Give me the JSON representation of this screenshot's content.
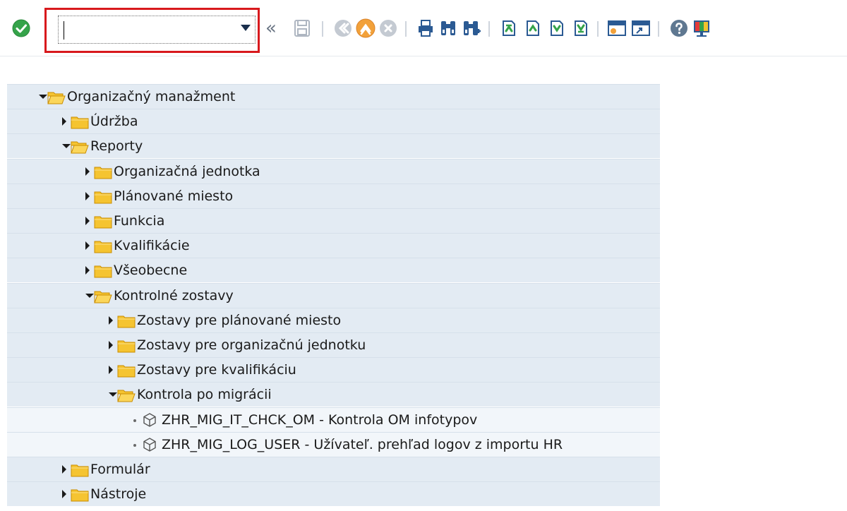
{
  "toolbar": {
    "command_field": {
      "value": "",
      "placeholder": ""
    },
    "back_glyph": "«",
    "icons": [
      "enter-icon",
      "command-dropdown-icon",
      "back-icon",
      "save-icon",
      "back-green-icon",
      "exit-icon",
      "cancel-icon",
      "print-icon",
      "find-icon",
      "find-next-icon",
      "first-page-icon",
      "previous-page-icon",
      "next-page-icon",
      "last-page-icon",
      "create-session-icon",
      "generate-shortcut-icon",
      "help-icon",
      "customize-layout-icon"
    ]
  },
  "tree": {
    "nodes": [
      {
        "label": "Organizačný manažment",
        "state": "expanded",
        "level": 0
      },
      {
        "label": "Údržba",
        "state": "collapsed",
        "level": 1
      },
      {
        "label": "Reporty",
        "state": "expanded",
        "level": 1
      },
      {
        "label": "Organizačná jednotka",
        "state": "collapsed",
        "level": 2
      },
      {
        "label": "Plánované miesto",
        "state": "collapsed",
        "level": 2
      },
      {
        "label": "Funkcia",
        "state": "collapsed",
        "level": 2
      },
      {
        "label": "Kvalifikácie",
        "state": "collapsed",
        "level": 2
      },
      {
        "label": "Všeobecne",
        "state": "collapsed",
        "level": 2
      },
      {
        "label": "Kontrolné zostavy",
        "state": "expanded",
        "level": 2
      },
      {
        "label": "Zostavy pre plánované miesto",
        "state": "collapsed",
        "level": 3
      },
      {
        "label": "Zostavy pre organizačnú jednotku",
        "state": "collapsed",
        "level": 3
      },
      {
        "label": "Zostavy pre kvalifikáciu",
        "state": "collapsed",
        "level": 3
      },
      {
        "label": "Kontrola po migrácii",
        "state": "expanded",
        "level": 3
      },
      {
        "label": "ZHR_MIG_IT_CHCK_OM - Kontrola OM infotypov",
        "state": "leaf",
        "level": 4
      },
      {
        "label": "ZHR_MIG_LOG_USER - Užívateľ. prehľad logov z importu HR",
        "state": "leaf",
        "level": 4
      },
      {
        "label": "Formulár",
        "state": "collapsed",
        "level": 1
      },
      {
        "label": "Nástroje",
        "state": "collapsed",
        "level": 1
      }
    ]
  },
  "colors": {
    "row_band": "#e3ebf3",
    "folder_fill": "#f5c431",
    "folder_stroke": "#c98c00",
    "highlight_box": "#d8191d",
    "enter_green": "#35a34a",
    "toolbar_icon_blue": "#2b5a93"
  }
}
